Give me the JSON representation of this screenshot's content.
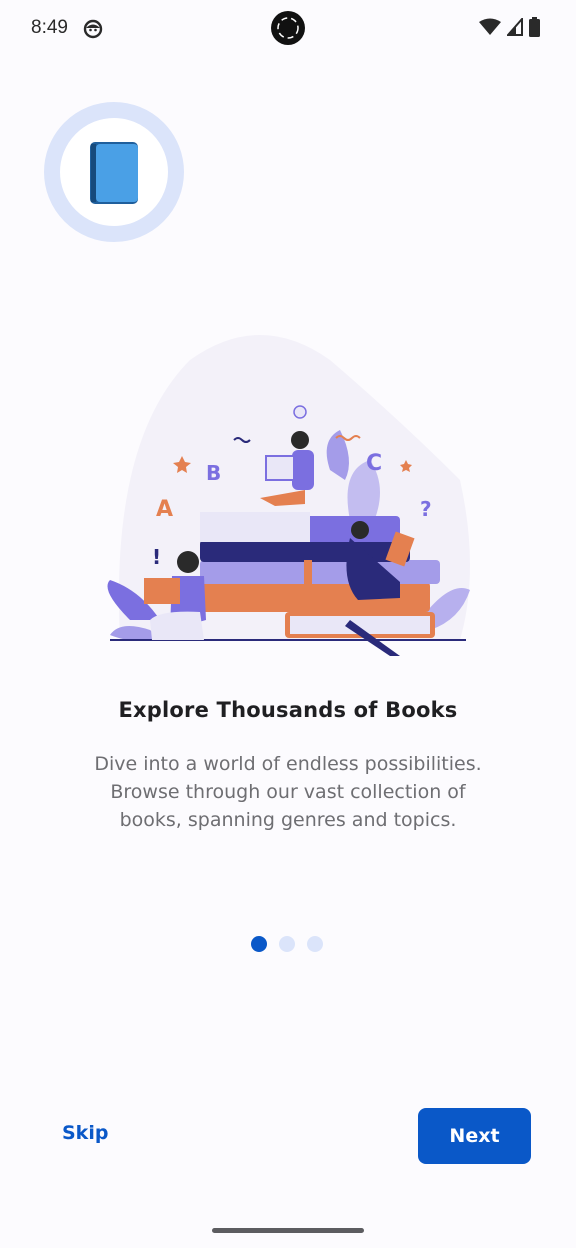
{
  "status_bar": {
    "time": "8:49",
    "icons": [
      "face-icon",
      "wifi-icon",
      "signal-icon",
      "battery-icon"
    ]
  },
  "onboarding": {
    "title": "Explore Thousands of Books",
    "description_line1": "Dive into a world of endless possibilities.",
    "description_line2": "Browse through our vast collection of books, spanning genres and topics.",
    "page_indicator": {
      "current": 1,
      "total": 3
    }
  },
  "actions": {
    "skip_label": "Skip",
    "next_label": "Next"
  },
  "colors": {
    "primary": "#0a58c8",
    "dot_inactive": "#dbe4fa",
    "logo_ring": "#dbe4fa",
    "book_blue": "#4aa0e6"
  }
}
